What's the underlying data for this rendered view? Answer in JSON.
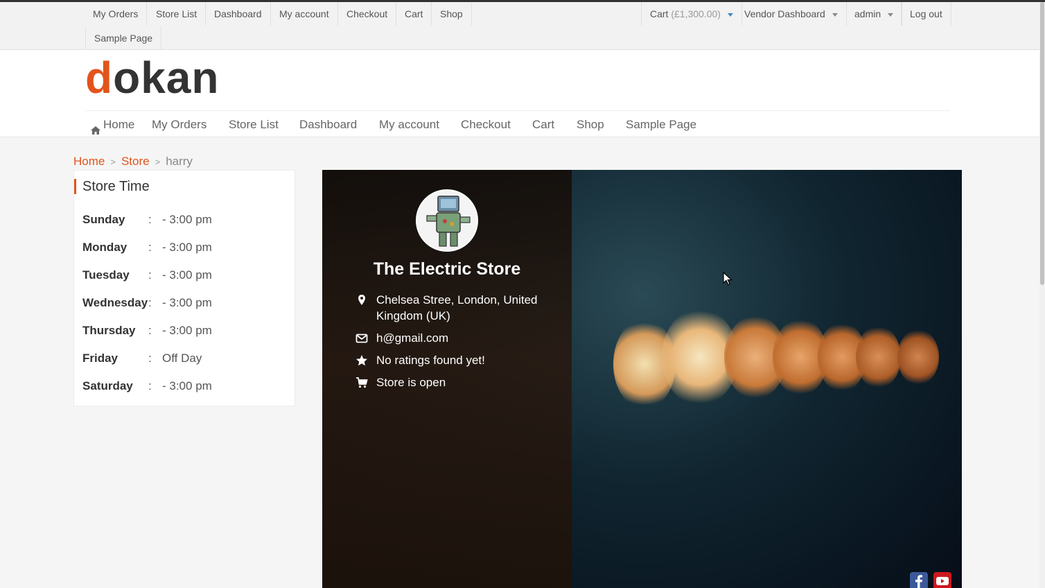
{
  "topbar": {
    "items": [
      "My Orders",
      "Store List",
      "Dashboard",
      "My account",
      "Checkout",
      "Cart",
      "Shop",
      "Sample Page"
    ],
    "cart_label": "Cart",
    "cart_amount": "(£1,300.00)",
    "vendor_dashboard": "Vendor Dashboard",
    "user": "admin",
    "logout": "Log out"
  },
  "header": {
    "logo_first": "d",
    "logo_rest": "okan"
  },
  "nav": {
    "items": [
      "Home",
      "My Orders",
      "Store List",
      "Dashboard",
      "My account",
      "Checkout",
      "Cart",
      "Shop",
      "Sample Page"
    ]
  },
  "breadcrumb": {
    "home": "Home",
    "store": "Store",
    "current": "harry",
    "separator": ">"
  },
  "store_time": {
    "title": "Store Time",
    "colon": ":",
    "days": [
      {
        "day": "Sunday",
        "hours": "- 3:00 pm"
      },
      {
        "day": "Monday",
        "hours": "- 3:00 pm"
      },
      {
        "day": "Tuesday",
        "hours": "- 3:00 pm"
      },
      {
        "day": "Wednesday",
        "hours": "- 3:00 pm"
      },
      {
        "day": "Thursday",
        "hours": "- 3:00 pm"
      },
      {
        "day": "Friday",
        "hours": "Off Day"
      },
      {
        "day": "Saturday",
        "hours": "- 3:00 pm"
      }
    ]
  },
  "store": {
    "name": "The Electric Store",
    "address": "Chelsea Stree, London, United Kingdom (UK)",
    "email": "h@gmail.com",
    "rating": "No ratings found yet!",
    "status": "Store is open"
  },
  "icons": {
    "address": "map-marker-icon",
    "email": "envelope-icon",
    "rating": "star-icon",
    "status": "cart-icon",
    "social": [
      "facebook-icon",
      "youtube-icon"
    ]
  },
  "colors": {
    "accent": "#e2541b",
    "facebook": "#3b5998",
    "youtube": "#cc181e"
  }
}
